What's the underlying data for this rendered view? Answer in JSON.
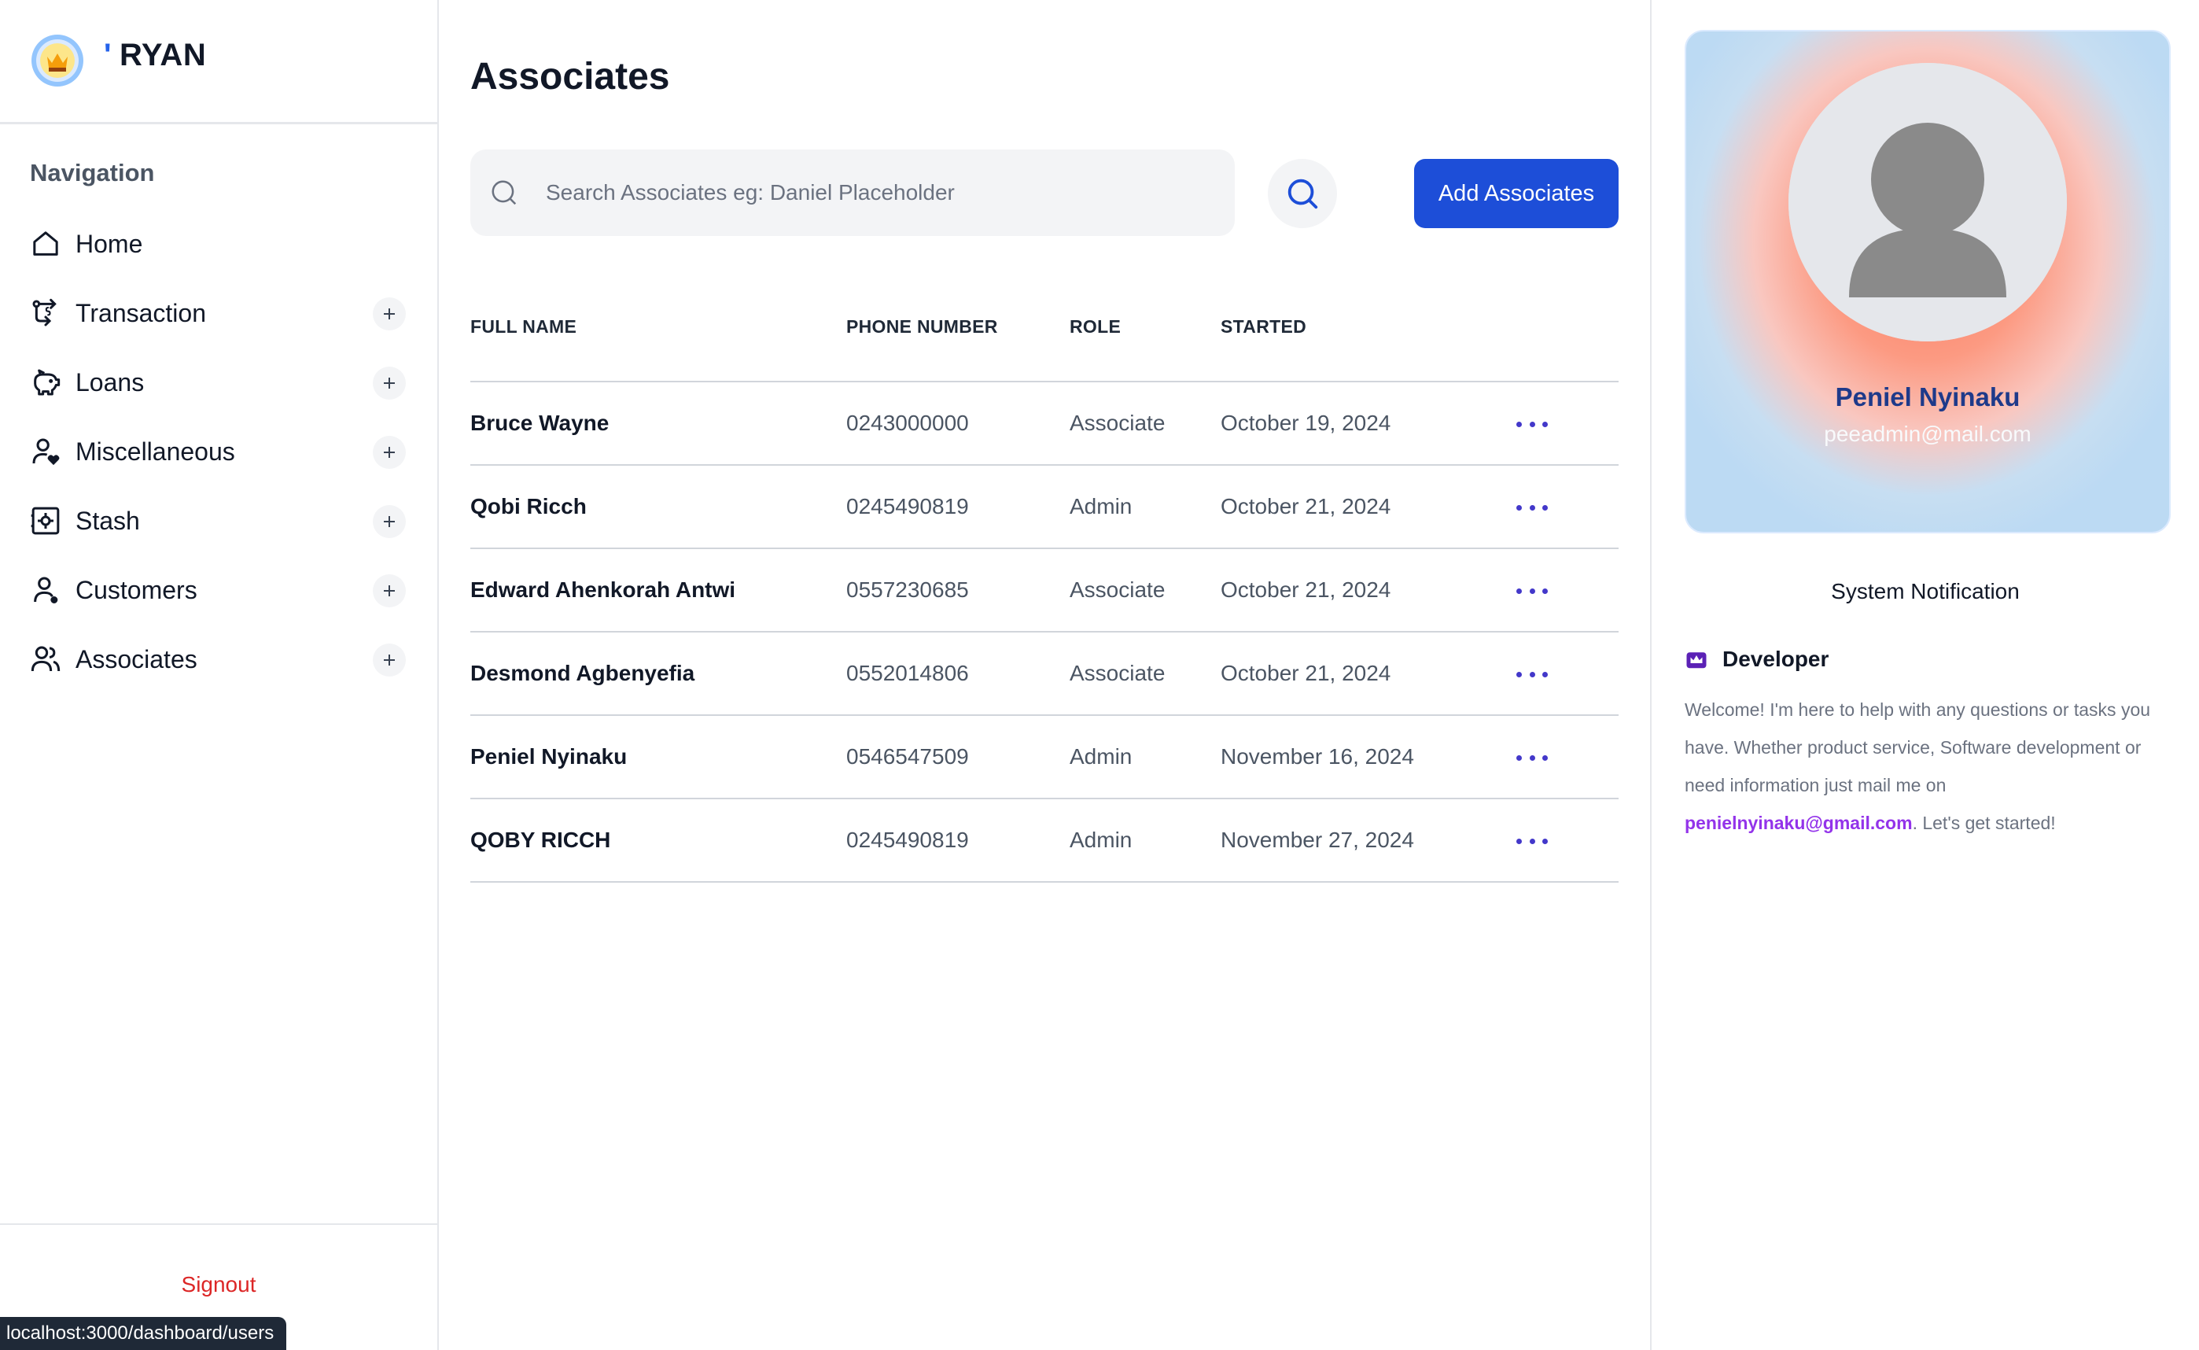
{
  "brand": {
    "name": "RYAN",
    "prefix": "'"
  },
  "nav": {
    "heading": "Navigation",
    "items": [
      {
        "label": "Home",
        "icon": "home-icon",
        "expandable": false
      },
      {
        "label": "Transaction",
        "icon": "transaction-icon",
        "expandable": true
      },
      {
        "label": "Loans",
        "icon": "piggy-bank-icon",
        "expandable": true
      },
      {
        "label": "Miscellaneous",
        "icon": "user-heart-icon",
        "expandable": true
      },
      {
        "label": "Stash",
        "icon": "safe-icon",
        "expandable": true
      },
      {
        "label": "Customers",
        "icon": "user-icon",
        "expandable": true
      },
      {
        "label": "Associates",
        "icon": "users-icon",
        "expandable": true
      }
    ]
  },
  "footer": {
    "signout": "Signout",
    "status_url": "localhost:3000/dashboard/users"
  },
  "main": {
    "title": "Associates",
    "search": {
      "placeholder": "Search Associates eg: Daniel Placeholder",
      "value": ""
    },
    "add_button": "Add Associates"
  },
  "table": {
    "headers": [
      "FULL NAME",
      "PHONE NUMBER",
      "ROLE",
      "STARTED"
    ],
    "rows": [
      {
        "name": "Bruce Wayne",
        "phone": "0243000000",
        "role": "Associate",
        "started": "October 19, 2024"
      },
      {
        "name": "Qobi Ricch",
        "phone": "0245490819",
        "role": "Admin",
        "started": "October 21, 2024"
      },
      {
        "name": "Edward Ahenkorah Antwi",
        "phone": "0557230685",
        "role": "Associate",
        "started": "October 21, 2024"
      },
      {
        "name": "Desmond Agbenyefia",
        "phone": "0552014806",
        "role": "Associate",
        "started": "October 21, 2024"
      },
      {
        "name": "Peniel Nyinaku",
        "phone": "0546547509",
        "role": "Admin",
        "started": "November 16, 2024"
      },
      {
        "name": "QOBY RICCH",
        "phone": "0245490819",
        "role": "Admin",
        "started": "November 27, 2024"
      }
    ]
  },
  "profile": {
    "name": "Peniel Nyinaku",
    "email": "peeadmin@mail.com"
  },
  "notifications": {
    "title": "System Notification",
    "developer": {
      "title": "Developer",
      "message_before": "Welcome! I'm here to help with any questions or tasks you have. Whether product service, Software development or need information just mail me on ",
      "email": "penielnyinaku@gmail.com",
      "message_after": ". Let's get started!"
    }
  },
  "colors": {
    "accent": "#1d4ed8",
    "danger": "#dc2626",
    "link": "#9333ea",
    "dots": "#4338ca"
  }
}
